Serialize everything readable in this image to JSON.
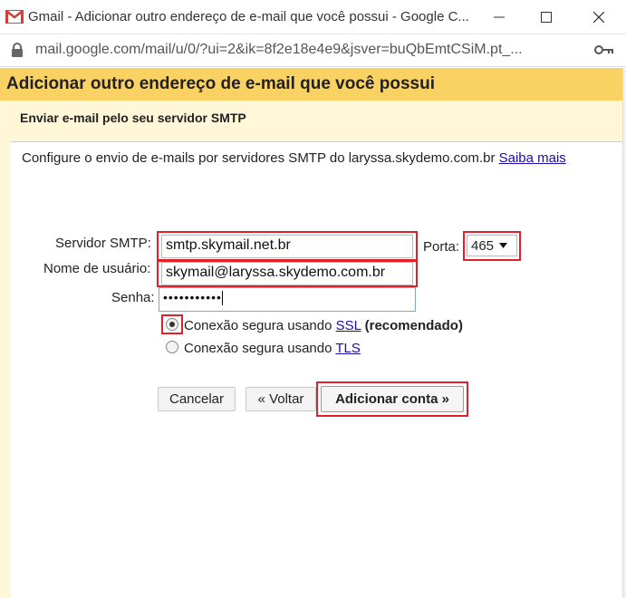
{
  "window": {
    "title": "Gmail - Adicionar outro endereço de e-mail que você possui - Google C...",
    "url": "mail.google.com/mail/u/0/?ui=2&ik=8f2e18e4e9&jsver=buQbEmtCSiM.pt_..."
  },
  "page": {
    "title": "Adicionar outro endereço de e-mail que você possui",
    "section_title": "Enviar e-mail pelo seu servidor SMTP",
    "description": "Configure o envio de e-mails por servidores SMTP do laryssa.skydemo.com.br",
    "learn_more": "Saiba mais"
  },
  "form": {
    "smtp_label": "Servidor SMTP:",
    "smtp_value": "smtp.skymail.net.br",
    "port_label": "Porta:",
    "port_value": "465",
    "user_label": "Nome de usuário:",
    "user_value": "skymail@laryssa.skydemo.com.br",
    "password_label": "Senha:",
    "password_value": "•••••••••••",
    "ssl_prefix": "Conexão segura usando",
    "ssl_link": "SSL",
    "ssl_suffix": "(recomendado)",
    "tls_prefix": "Conexão segura usando",
    "tls_link": "TLS"
  },
  "buttons": {
    "cancel": "Cancelar",
    "back": "« Voltar",
    "add_account": "Adicionar conta »"
  },
  "colors": {
    "header_band": "#fad163",
    "panel": "#fff7d7",
    "highlight": "#e0202b",
    "link": "#1a0dab"
  }
}
